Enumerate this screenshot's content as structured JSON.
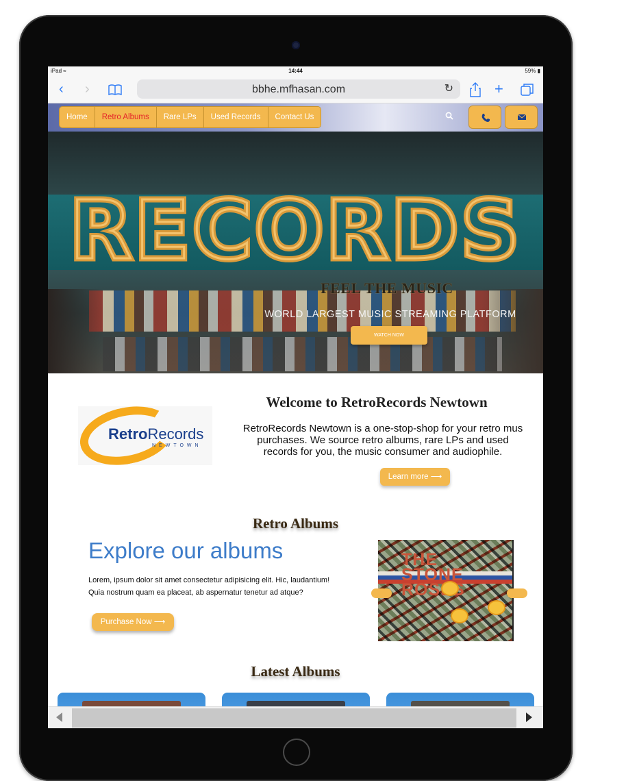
{
  "status_bar": {
    "carrier": "iPad",
    "time": "14:44",
    "battery": "59%"
  },
  "browser": {
    "url": "bbhe.mfhasan.com"
  },
  "nav": {
    "items": [
      {
        "label": "Home",
        "active": false
      },
      {
        "label": "Retro Albums",
        "active": true
      },
      {
        "label": "Rare LPs",
        "active": false
      },
      {
        "label": "Used Records",
        "active": false
      },
      {
        "label": "Contact Us",
        "active": false
      }
    ]
  },
  "hero": {
    "sign_text": "RECORDS",
    "headline": "FEEL THE MUSIC",
    "subtitle": "WORLD LARGEST MUSIC STREAMING PLATFORM",
    "cta": "WATCH NOW"
  },
  "welcome": {
    "logo_bold": "Retro",
    "logo_light": "Records",
    "logo_sub": "NEWTOWN",
    "title": "Welcome to RetroRecords Newtown",
    "text": "RetroRecords Newtown is a one-stop-shop for your retro mus\npurchases. We source retro albums, rare LPs and used\nrecords for you, the music consumer and audiophile.",
    "cta": "Learn more ⟶"
  },
  "retro": {
    "heading": "Retro Albums",
    "title": "Explore our albums",
    "text": "Lorem, ipsum dolor sit amet consectetur adipisicing elit. Hic, laudantium! Quia nostrum quam ea placeat, ab aspernatur tenetur ad atque?",
    "cta": "Purchase Now ⟶",
    "album_cover_text": "THE STONE ROSES"
  },
  "latest": {
    "heading": "Latest Albums"
  },
  "colors": {
    "accent": "#f3b84e",
    "active_nav": "#e5252a",
    "link_blue": "#3d7cc9"
  }
}
